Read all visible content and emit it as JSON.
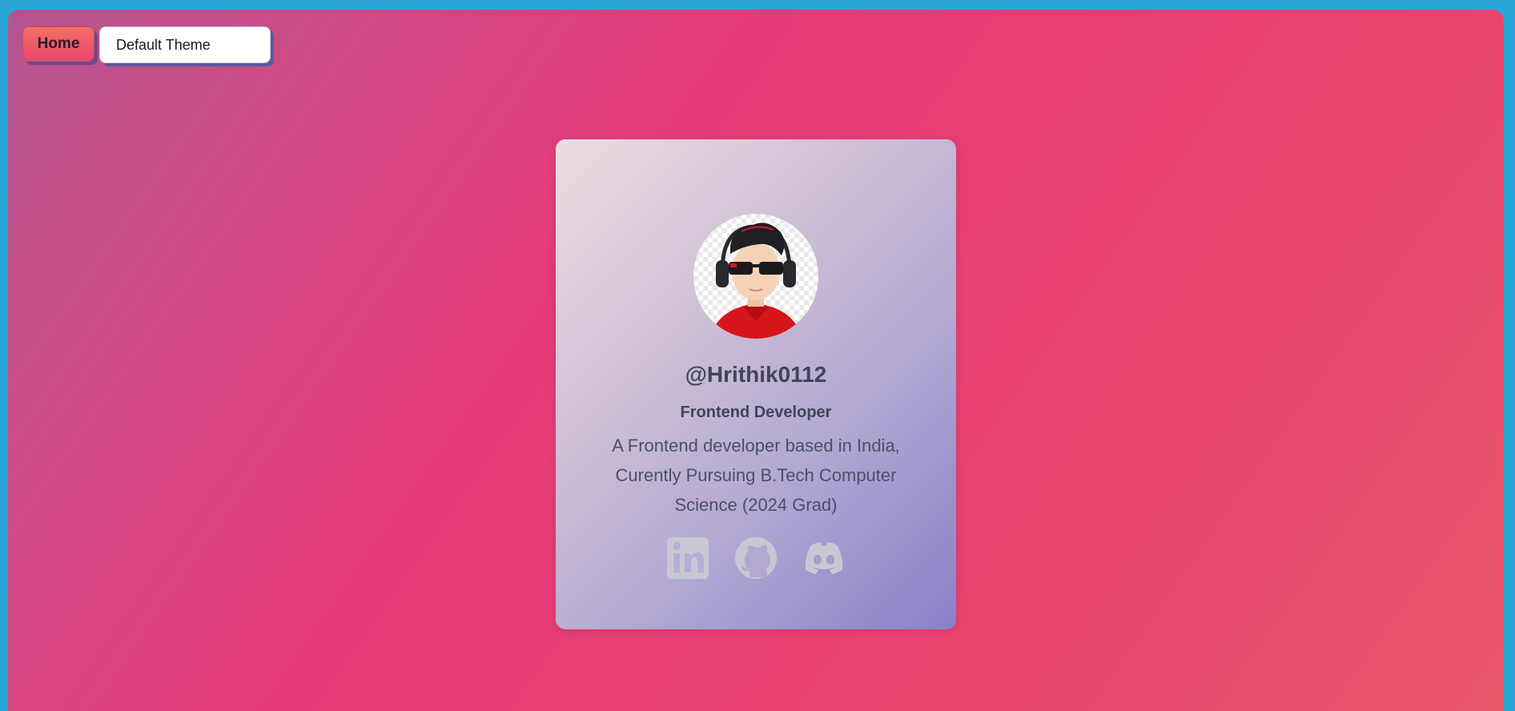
{
  "nav": {
    "home_label": "Home",
    "theme_selected": "Default Theme"
  },
  "profile": {
    "username": "@Hrithik0112",
    "role": "Frontend Developer",
    "bio": "A Frontend developer based in India, Curently Pursuing B.Tech Computer Science (2024 Grad)"
  },
  "socials": [
    {
      "icon": "linkedin-icon"
    },
    {
      "icon": "github-icon"
    },
    {
      "icon": "discord-icon"
    }
  ],
  "colors": {
    "frame": "#2aa6d6",
    "background_pink": "#e63a78",
    "card_text": "#3f4558",
    "social_icon": "#c8c8d4"
  }
}
